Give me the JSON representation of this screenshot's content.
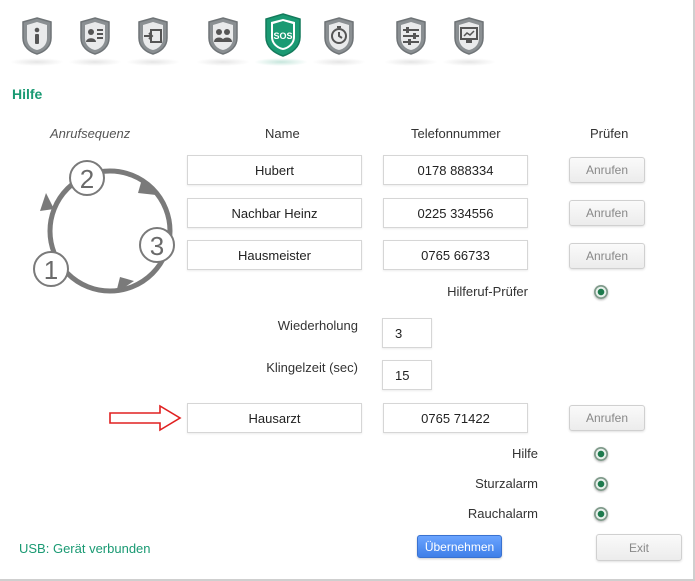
{
  "toolbar": {
    "items": [
      {
        "icon": "info-icon"
      },
      {
        "icon": "contacts-icon"
      },
      {
        "icon": "import-icon"
      },
      {
        "icon": "people-icon"
      },
      {
        "icon": "sos-icon",
        "label": "SOS",
        "active": true
      },
      {
        "icon": "timer-icon"
      },
      {
        "icon": "settings-sliders-icon"
      },
      {
        "icon": "display-icon"
      }
    ],
    "colors": {
      "inactive": "#8a8f92",
      "active": "#1a9a73"
    }
  },
  "section": {
    "title": "Hilfe"
  },
  "diagram": {
    "title": "Anrufsequenz",
    "steps": [
      "1",
      "2",
      "3"
    ]
  },
  "columns": {
    "name": "Name",
    "phone": "Telefonnummer",
    "test": "Prüfen"
  },
  "contacts": [
    {
      "name": "Hubert",
      "phone": "0178 888334",
      "button": "Anrufen"
    },
    {
      "name": "Nachbar Heinz",
      "phone": "0225 334556",
      "button": "Anrufen"
    },
    {
      "name": "Hausmeister",
      "phone": "0765 66733",
      "button": "Anrufen"
    }
  ],
  "checker": {
    "label": "Hilferuf-Prüfer",
    "checked": true
  },
  "repeat": {
    "label": "Wiederholung",
    "value": "3"
  },
  "ringtime": {
    "label": "Klingelzeit (sec)",
    "value": "15"
  },
  "doctor": {
    "name": "Hausarzt",
    "phone": "0765 71422",
    "button": "Anrufen"
  },
  "options": [
    {
      "label": "Hilfe",
      "checked": true
    },
    {
      "label": "Sturzalarm",
      "checked": true
    },
    {
      "label": "Rauchalarm",
      "checked": true
    }
  ],
  "status": {
    "text": "USB: Gerät verbunden"
  },
  "actions": {
    "apply": "Übernehmen",
    "exit": "Exit"
  },
  "accent": {
    "green": "#1a9a73",
    "arrow_red": "#e02020",
    "apply_blue": "#4a8af0"
  }
}
